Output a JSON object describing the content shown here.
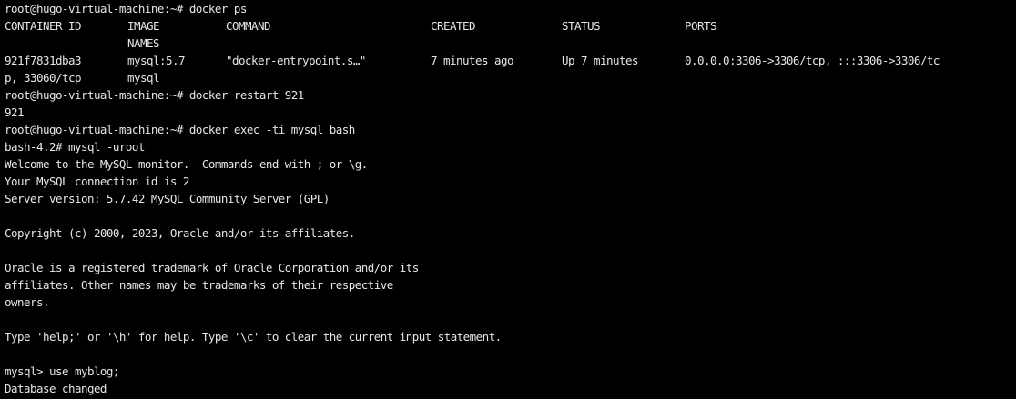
{
  "terminal": {
    "lines": [
      "root@hugo-virtual-machine:~# docker ps",
      null,
      null,
      null,
      null,
      "root@hugo-virtual-machine:~# docker restart 921",
      "921",
      "root@hugo-virtual-machine:~# docker exec -ti mysql bash",
      "bash-4.2# mysql -uroot",
      "Welcome to the MySQL monitor.  Commands end with ; or \\g.",
      "Your MySQL connection id is 2",
      "Server version: 5.7.42 MySQL Community Server (GPL)",
      "",
      "Copyright (c) 2000, 2023, Oracle and/or its affiliates.",
      "",
      "Oracle is a registered trademark of Oracle Corporation and/or its",
      "affiliates. Other names may be trademarks of their respective",
      "owners.",
      "",
      "Type 'help;' or '\\h' for help. Type '\\c' to clear the current input statement.",
      "",
      "mysql> use myblog;",
      "Database changed"
    ],
    "docker_ps": {
      "headers": [
        "CONTAINER ID",
        "IMAGE",
        "COMMAND",
        "CREATED",
        "STATUS",
        "PORTS"
      ],
      "headers_wrap": "NAMES",
      "row": [
        "921f7831dba3",
        "mysql:5.7",
        "\"docker-entrypoint.s…\"",
        "7 minutes ago",
        "Up 7 minutes",
        "0.0.0.0:3306->3306/tcp, :::3306->3306/tc"
      ],
      "row_wrap": [
        "p, 33060/tcp",
        "mysql"
      ]
    }
  }
}
